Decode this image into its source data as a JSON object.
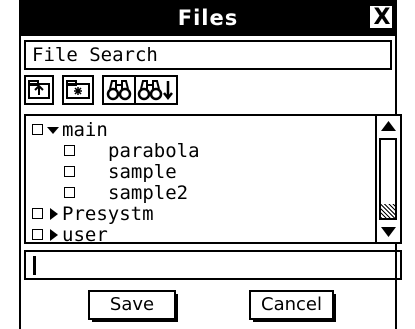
{
  "window": {
    "title": "Files",
    "close_glyph": "X"
  },
  "header": {
    "label": "File Search"
  },
  "toolbar": {
    "buttons": [
      {
        "name": "up-folder-icon"
      },
      {
        "name": "new-folder-icon"
      },
      {
        "name": "search-icon"
      },
      {
        "name": "search-next-icon"
      }
    ]
  },
  "tree": {
    "items": [
      {
        "label": "main",
        "type": "folder",
        "expanded": true
      },
      {
        "label": "parabola",
        "type": "file"
      },
      {
        "label": "sample",
        "type": "file"
      },
      {
        "label": "sample2",
        "type": "file"
      },
      {
        "label": "Presystm",
        "type": "folder",
        "expanded": false
      },
      {
        "label": "user",
        "type": "folder",
        "expanded": false
      }
    ]
  },
  "input": {
    "value": ""
  },
  "buttons": {
    "save": "Save",
    "cancel": "Cancel"
  }
}
